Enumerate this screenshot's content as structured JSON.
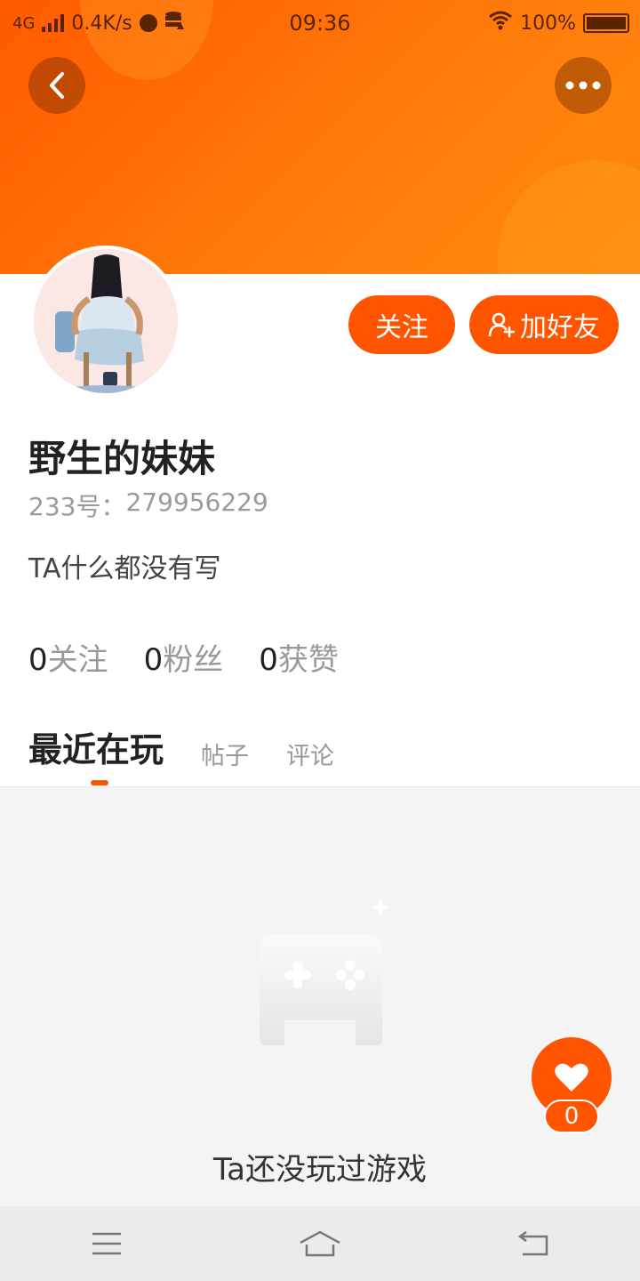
{
  "status_bar": {
    "network": "4G",
    "speed": "0.4K/s",
    "time": "09:36",
    "battery": "100%"
  },
  "header": {
    "back_icon": "chevron-left-icon",
    "more_icon": "more-dots-icon"
  },
  "profile": {
    "name": "野生的妹妹",
    "id_label": "233号：",
    "id_value": "279956229",
    "bio": "TA什么都没有写",
    "follow_label": "关注",
    "add_friend_label": "加好友"
  },
  "stats": [
    {
      "count": "0",
      "label": "关注"
    },
    {
      "count": "0",
      "label": "粉丝"
    },
    {
      "count": "0",
      "label": "获赞"
    }
  ],
  "tabs": [
    {
      "label": "最近在玩",
      "active": true
    },
    {
      "label": "帖子",
      "active": false
    },
    {
      "label": "评论",
      "active": false
    }
  ],
  "empty_state": {
    "text": "Ta还没玩过游戏",
    "icon": "gamepad-icon"
  },
  "like": {
    "count": "0",
    "icon": "heart-icon"
  },
  "colors": {
    "accent": "#ff5500",
    "banner": "#ff6e05"
  }
}
